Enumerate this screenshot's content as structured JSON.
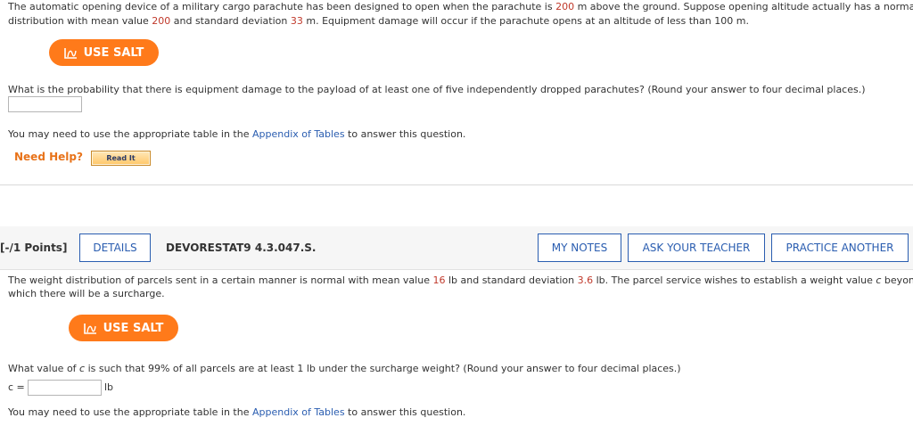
{
  "q1": {
    "line1_a": "The automatic opening device of a military cargo parachute has been designed to open when the parachute is ",
    "open_alt": "200",
    "line1_b": " m above the ground. Suppose opening altitude actually has a normal",
    "line2_a": "distribution with mean value ",
    "mean": "200",
    "line2_b": " and standard deviation ",
    "sd": "33",
    "line2_c": " m. Equipment damage will occur if the parachute opens at an altitude of less than 100 m.",
    "salt_label": "USE SALT",
    "question": "What is the probability that there is equipment damage to the payload of at least one of five independently dropped parachutes? (Round your answer to four decimal places.)",
    "answer_value": "",
    "table_a": "You may need to use the appropriate table in the ",
    "table_link": "Appendix of Tables",
    "table_b": " to answer this question.",
    "need_help": "Need Help?",
    "read_it": "Read It"
  },
  "q2": {
    "points": "[-/1 Points]",
    "details": "DETAILS",
    "code": "DEVORESTAT9 4.3.047.S.",
    "my_notes": "MY NOTES",
    "ask_teacher": "ASK YOUR TEACHER",
    "practice": "PRACTICE ANOTHER",
    "line1_a": "The weight distribution of parcels sent in a certain manner is normal with mean value ",
    "mean": "16",
    "line1_b": " lb and standard deviation ",
    "sd": "3.6",
    "line1_c": " lb. The parcel service wishes to establish a weight value ",
    "c_var": "c",
    "line1_d": " beyond",
    "line2": "which there will be a surcharge.",
    "salt_label": "USE SALT",
    "question_a": "What value of ",
    "question_c": "c",
    "question_b": " is such that 99% of all parcels are at least 1 lb under the surcharge weight? (Round your answer to four decimal places.)",
    "c_label": "c =",
    "answer_value": "",
    "unit": "lb",
    "table_a": "You may need to use the appropriate table in the ",
    "table_link": "Appendix of Tables",
    "table_b": " to answer this question."
  },
  "colors": {
    "salt_orange": "#ff7a1a",
    "link_blue": "#2a5db0",
    "value_red": "#c0392b"
  },
  "icons": {
    "salt": "salt-calculator-icon"
  }
}
